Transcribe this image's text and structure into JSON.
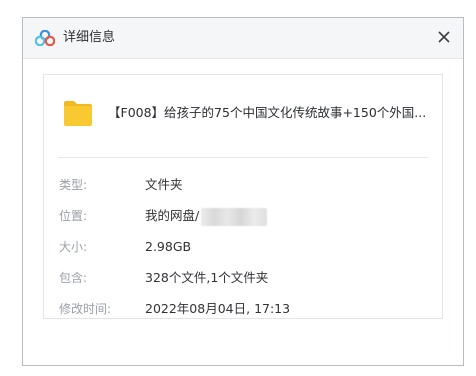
{
  "window": {
    "title": "详细信息",
    "logo_icon": "baidu-netdisk-logo",
    "close_icon": "close-icon"
  },
  "file": {
    "icon": "folder-icon",
    "name": "【F008】给孩子的75个中国文化传统故事+150个外国..."
  },
  "details": {
    "type_label": "类型:",
    "type_value": "文件夹",
    "location_label": "位置:",
    "location_value": "我的网盘/",
    "size_label": "大小:",
    "size_value": "2.98GB",
    "contains_label": "包含:",
    "contains_value": "328个文件,1个文件夹",
    "modified_label": "修改时间:",
    "modified_value": "2022年08月04日, 17:13"
  },
  "colors": {
    "folder_yellow": "#f9c932",
    "logo_blue": "#3a8ee6",
    "logo_cyan": "#4fc3e8",
    "logo_red": "#e8574a"
  }
}
